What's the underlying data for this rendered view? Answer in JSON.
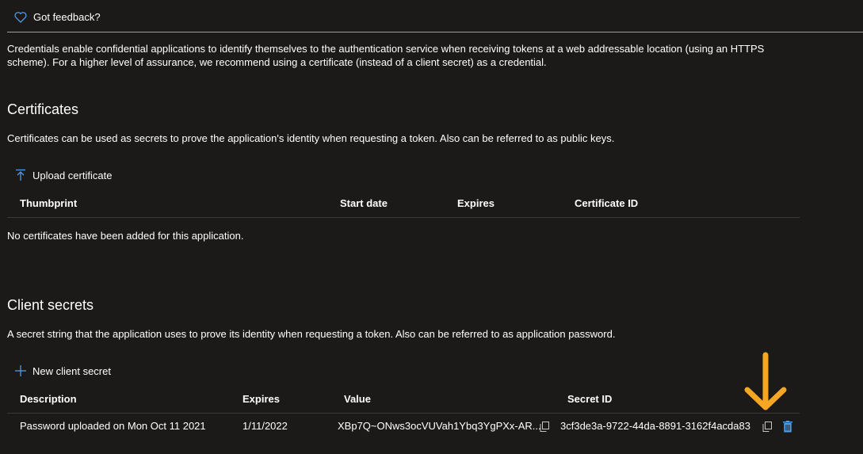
{
  "feedback": {
    "label": "Got feedback?"
  },
  "intro": "Credentials enable confidential applications to identify themselves to the authentication service when receiving tokens at a web addressable location (using an HTTPS scheme). For a higher level of assurance, we recommend using a certificate (instead of a client secret) as a credential.",
  "certificates": {
    "title": "Certificates",
    "description": "Certificates can be used as secrets to prove the application's identity when requesting a token. Also can be referred to as public keys.",
    "upload_label": "Upload certificate",
    "columns": [
      "Thumbprint",
      "Start date",
      "Expires",
      "Certificate ID"
    ],
    "empty_message": "No certificates have been added for this application."
  },
  "secrets": {
    "title": "Client secrets",
    "description": "A secret string that the application uses to prove its identity when requesting a token. Also can be referred to as application password.",
    "new_label": "New client secret",
    "columns": [
      "Description",
      "Expires",
      "Value",
      "Secret ID"
    ],
    "rows": [
      {
        "description": "Password uploaded on Mon Oct 11 2021",
        "expires": "1/11/2022",
        "value": "XBp7Q~ONws3ocVUVah1Ybq3YgPXx-AR...",
        "secret_id": "3cf3de3a-9722-44da-8891-3162f4acda83"
      }
    ]
  },
  "colors": {
    "background": "#1b1a19",
    "accent": "#4f9de8",
    "annotation_arrow": "#f5a623"
  }
}
